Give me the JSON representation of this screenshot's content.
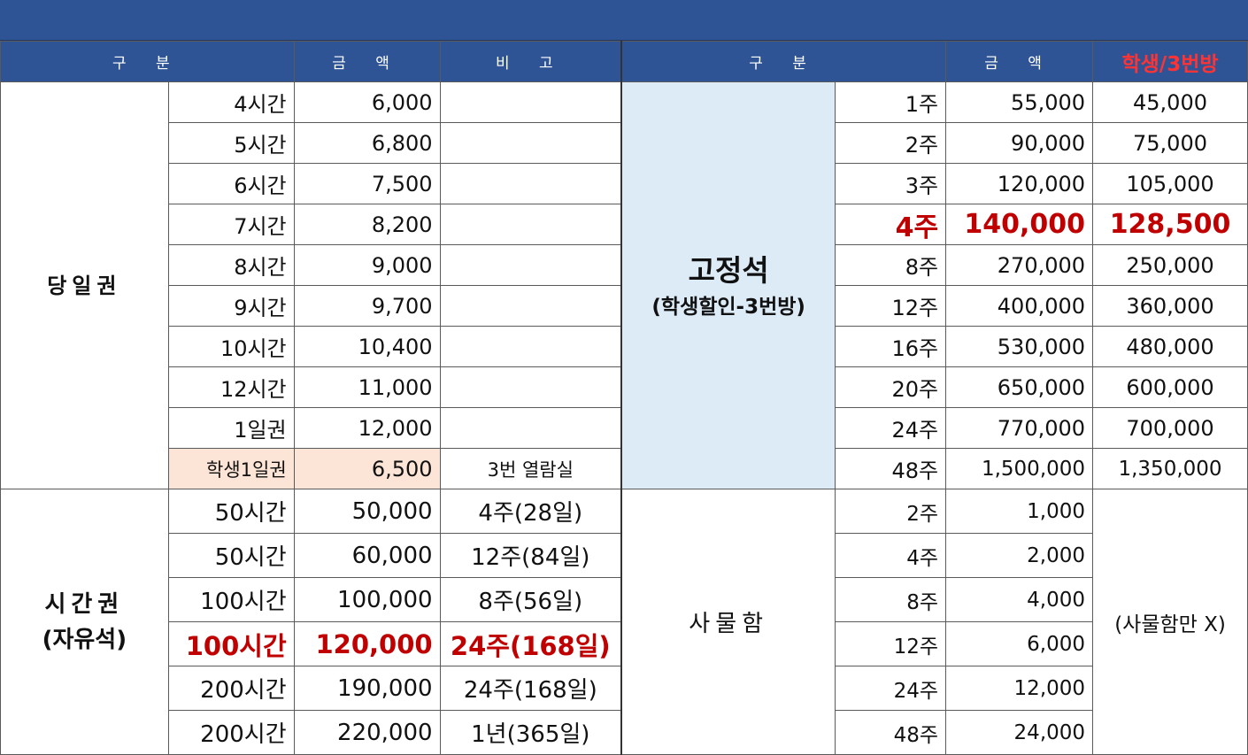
{
  "header": {
    "col1": "구 분",
    "col2": "금 액",
    "col3": "비 고",
    "col4": "구 분",
    "col5": "금 액",
    "col6": "학생/3번방"
  },
  "daily": {
    "category": "당일권",
    "rows": [
      {
        "duration": "4시간",
        "price": "6,000",
        "note": ""
      },
      {
        "duration": "5시간",
        "price": "6,800",
        "note": ""
      },
      {
        "duration": "6시간",
        "price": "7,500",
        "note": ""
      },
      {
        "duration": "7시간",
        "price": "8,200",
        "note": ""
      },
      {
        "duration": "8시간",
        "price": "9,000",
        "note": ""
      },
      {
        "duration": "9시간",
        "price": "9,700",
        "note": ""
      },
      {
        "duration": "10시간",
        "price": "10,400",
        "note": ""
      },
      {
        "duration": "12시간",
        "price": "11,000",
        "note": ""
      },
      {
        "duration": "1일권",
        "price": "12,000",
        "note": ""
      },
      {
        "duration": "학생1일권",
        "price": "6,500",
        "note": "3번 열람실"
      }
    ]
  },
  "fixed_seat": {
    "category": "고정석",
    "subtitle": "(학생할인-3번방)",
    "rows": [
      {
        "period": "1주",
        "price": "55,000",
        "student": "45,000"
      },
      {
        "period": "2주",
        "price": "90,000",
        "student": "75,000"
      },
      {
        "period": "3주",
        "price": "120,000",
        "student": "105,000"
      },
      {
        "period": "4주",
        "price": "140,000",
        "student": "128,500"
      },
      {
        "period": "8주",
        "price": "270,000",
        "student": "250,000"
      },
      {
        "period": "12주",
        "price": "400,000",
        "student": "360,000"
      },
      {
        "period": "16주",
        "price": "530,000",
        "student": "480,000"
      },
      {
        "period": "20주",
        "price": "650,000",
        "student": "600,000"
      },
      {
        "period": "24주",
        "price": "770,000",
        "student": "700,000"
      },
      {
        "period": "48주",
        "price": "1,500,000",
        "student": "1,350,000"
      }
    ]
  },
  "time_pass": {
    "category": "시간권",
    "subtitle": "(자유석)",
    "rows": [
      {
        "duration": "50시간",
        "price": "50,000",
        "note": "4주(28일)"
      },
      {
        "duration": "50시간",
        "price": "60,000",
        "note": "12주(84일)"
      },
      {
        "duration": "100시간",
        "price": "100,000",
        "note": "8주(56일)"
      },
      {
        "duration": "100시간",
        "price": "120,000",
        "note": "24주(168일)"
      },
      {
        "duration": "200시간",
        "price": "190,000",
        "note": "24주(168일)"
      },
      {
        "duration": "200시간",
        "price": "220,000",
        "note": "1년(365일)"
      }
    ]
  },
  "locker": {
    "category": "사물함",
    "note": "(사물함만 X)",
    "rows": [
      {
        "period": "2주",
        "price": "1,000"
      },
      {
        "period": "4주",
        "price": "2,000"
      },
      {
        "period": "8주",
        "price": "4,000"
      },
      {
        "period": "12주",
        "price": "6,000"
      },
      {
        "period": "24주",
        "price": "12,000"
      },
      {
        "period": "48주",
        "price": "24,000"
      }
    ]
  },
  "colors": {
    "header_bg": "#2f5496",
    "highlight_red": "#c00000",
    "fixed_seat_bg": "#ddebf7",
    "student_day_bg": "#fce4d6"
  }
}
